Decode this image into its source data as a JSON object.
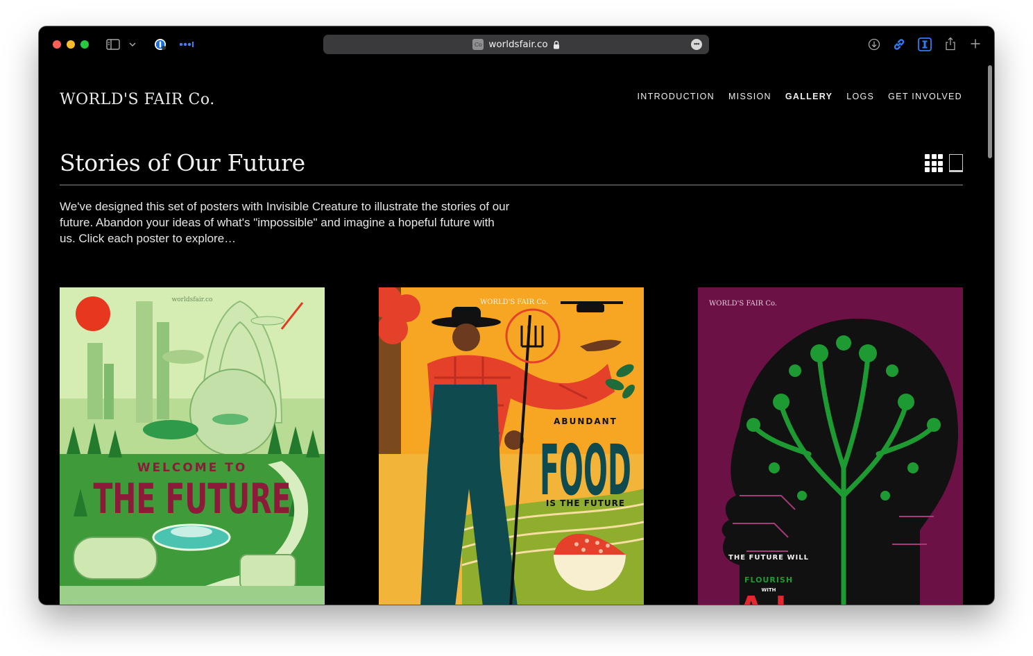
{
  "browser": {
    "url": "worldsfair.co",
    "icons": [
      "sidebar-icon",
      "chevron-down-icon",
      "password-icon",
      "extension-dots-icon",
      "lock-icon",
      "more-icon",
      "download-icon",
      "link-icon",
      "reader-icon",
      "share-icon",
      "new-tab-icon"
    ]
  },
  "site": {
    "logo": "WORLD'S FAIR Co.",
    "nav": [
      {
        "label": "INTRODUCTION",
        "active": false
      },
      {
        "label": "MISSION",
        "active": false
      },
      {
        "label": "GALLERY",
        "active": true
      },
      {
        "label": "LOGS",
        "active": false
      },
      {
        "label": "GET INVOLVED",
        "active": false
      }
    ],
    "title": "Stories of Our Future",
    "intro": "We've designed this set of posters with Invisible Creature to illustrate the stories of our future. Abandon your ideas of what's \"impossible\" and imagine a hopeful future with us. Click each poster to explore…",
    "view_modes": [
      "grid-view-icon",
      "single-view-icon"
    ]
  },
  "posters": [
    {
      "brand": "worldsfair.co",
      "headline_small": "WELCOME TO",
      "headline": "THE FUTURE",
      "colors": {
        "bg": "#b9dc95",
        "sun": "#e8371f",
        "title": "#8c1b3a"
      }
    },
    {
      "brand": "WORLD'S FAIR Co.",
      "headline_small": "ABUNDANT",
      "headline": "FOOD",
      "subline": "IS THE FUTURE",
      "colors": {
        "bg": "#f6a623",
        "title": "#0f4a4f",
        "shirt": "#e4402a"
      }
    },
    {
      "brand": "WORLD'S FAIR Co.",
      "headline_small": "THE FUTURE WILL",
      "headline_accent": "FLOURISH",
      "headline_with": "WITH",
      "headline": "A.I.",
      "colors": {
        "bg": "#6b1145",
        "head": "#111111",
        "tree": "#1e9a32"
      }
    }
  ]
}
